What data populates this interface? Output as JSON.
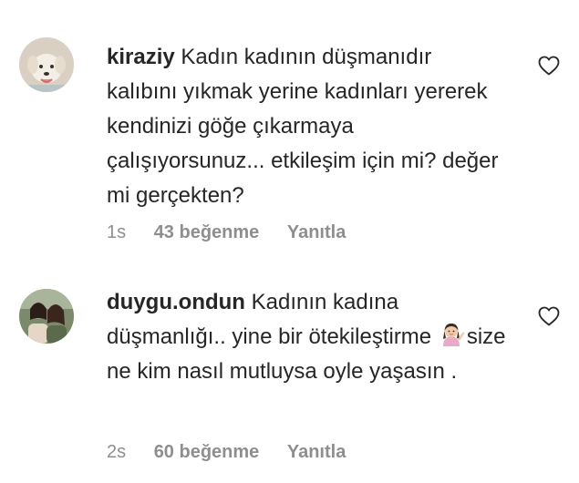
{
  "comments": [
    {
      "username": "kiraziy",
      "text": "Kadın kadının düşmanıdır kalıbını yıkmak yerine kadınları yererek kendinizi göğe çıkarmaya çalışıyorsunuz... etkileşim için mi? değer mi gerçekten?",
      "time": "1s",
      "likes": "43 beğenme",
      "reply": "Yanıtla",
      "avatar_icon": "puppy-photo"
    },
    {
      "username": "duygu.ondun",
      "text_before_emoji": "Kadının kadına düşmanlığı.. yine bir ötekileştirme ",
      "emoji": "woman-gesturing-emoji",
      "text_after_emoji": "size ne kim nasıl mutluysa oyle yaşasın .",
      "time": "2s",
      "likes": "60 beğenme",
      "reply": "Yanıtla",
      "avatar_icon": "two-women-photo"
    }
  ],
  "like_icon": "heart-outline-icon",
  "colors": {
    "text": "#262626",
    "secondary": "#8e8e8e",
    "background": "#ffffff"
  }
}
